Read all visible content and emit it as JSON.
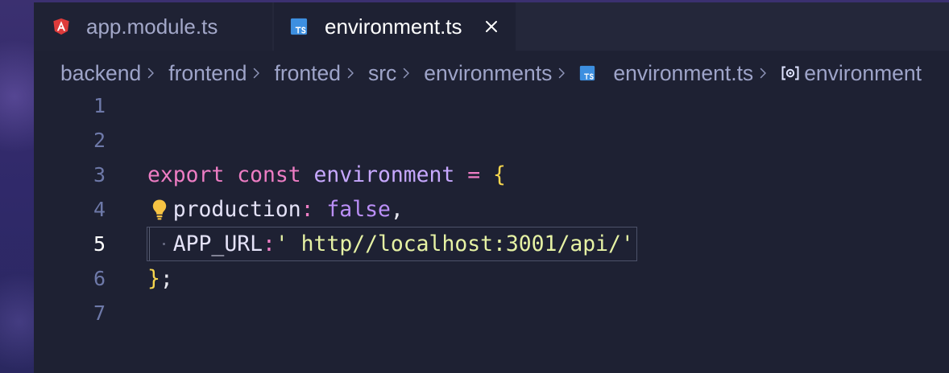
{
  "colors": {
    "editor_bg": "#1e2133",
    "tabbar_bg": "#24273a",
    "tab_active_bg": "#1e2133",
    "tab_inactive_bg": "#1f2234",
    "tab_inactive_fg": "#a3a8c9",
    "tab_active_fg": "#ffffff",
    "breadcrumb_fg": "#9ea4c9",
    "line_number": "#6e79a9",
    "line_number_active": "#ffffff",
    "keyword": "#ee7dc4",
    "identifier": "#c7a8ff",
    "operator": "#ee7dc4",
    "brace": "#f7d64e",
    "property": "#e4e2f7",
    "boolean": "#bb8ff7",
    "string": "#e6f2a4",
    "punctuation": "#e8e8f0",
    "angular": "#dd3b3b",
    "typescript": "#3d8fe0",
    "lightbulb": "#f6c343"
  },
  "tabs": [
    {
      "label": "app.module.ts",
      "icon": "angular-icon",
      "active": false
    },
    {
      "label": "environment.ts",
      "icon": "typescript-icon",
      "active": true,
      "close_icon": "close-icon"
    }
  ],
  "breadcrumb": {
    "separator_icon": "chevron-right-icon",
    "items": [
      {
        "label": "backend"
      },
      {
        "label": "frontend"
      },
      {
        "label": "fronted"
      },
      {
        "label": "src"
      },
      {
        "label": "environments"
      },
      {
        "label": "environment.ts",
        "icon": "typescript-icon"
      },
      {
        "label": "environment",
        "icon": "symbol-variable-icon"
      }
    ]
  },
  "editor": {
    "current_line": 5,
    "lines": [
      {
        "number": 1,
        "tokens": []
      },
      {
        "number": 2,
        "tokens": []
      },
      {
        "number": 3,
        "tokens": [
          "export",
          "const",
          "environment",
          "=",
          "{"
        ]
      },
      {
        "number": 4,
        "tokens": [
          "production",
          ":",
          "false",
          ","
        ],
        "gutter_icon": "lightbulb-icon"
      },
      {
        "number": 5,
        "tokens": [
          "APP_URL",
          ":",
          "' http//localhost:3001/api/'"
        ]
      },
      {
        "number": 6,
        "tokens": [
          "}",
          ";"
        ]
      },
      {
        "number": 7,
        "tokens": []
      }
    ]
  }
}
